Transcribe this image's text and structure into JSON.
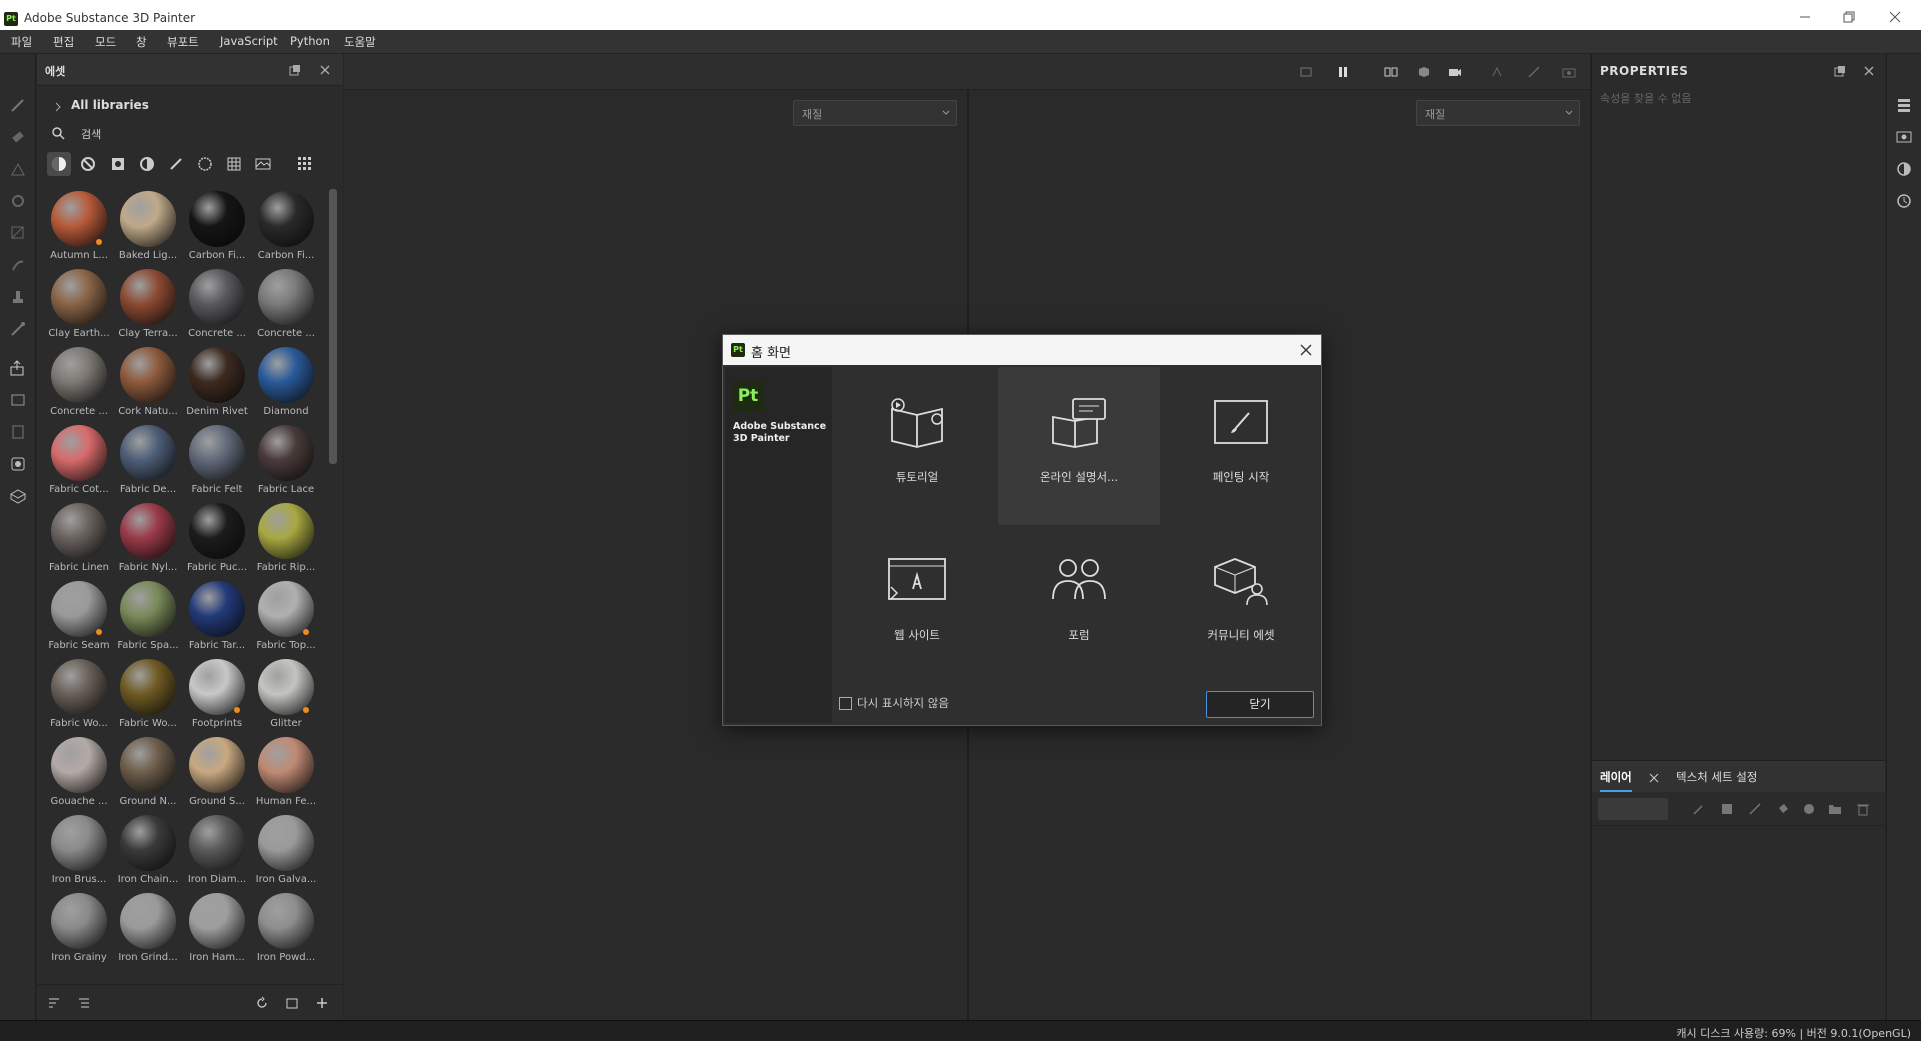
{
  "window": {
    "title": "Adobe Substance 3D Painter",
    "app_icon": "Pt"
  },
  "menu": [
    "파일",
    "편집",
    "모드",
    "창",
    "뷰포트",
    "JavaScript",
    "Python",
    "도움말"
  ],
  "assets": {
    "panel_title": "에셋",
    "library": "All libraries",
    "search_placeholder": "검색",
    "items": [
      {
        "label": "Autumn L...",
        "color": "#b85a3a",
        "new": true
      },
      {
        "label": "Baked Lig...",
        "color": "#bfa98a",
        "new": false
      },
      {
        "label": "Carbon Fi...",
        "color": "#151515",
        "new": false
      },
      {
        "label": "Carbon Fi...",
        "color": "#2a2a2a",
        "new": false
      },
      {
        "label": "Clay Earth...",
        "color": "#8a6446",
        "new": false
      },
      {
        "label": "Clay Terra...",
        "color": "#8c4a32",
        "new": false
      },
      {
        "label": "Concrete ...",
        "color": "#5a5a5e",
        "new": false
      },
      {
        "label": "Concrete ...",
        "color": "#7a7a7a",
        "new": false
      },
      {
        "label": "Concrete ...",
        "color": "#7d7873",
        "new": false
      },
      {
        "label": "Cork Natu...",
        "color": "#8e5a3c",
        "new": false
      },
      {
        "label": "Denim Rivet",
        "color": "#3d2a20",
        "new": false
      },
      {
        "label": "Diamond",
        "color": "#2a5a9a",
        "new": false
      },
      {
        "label": "Fabric Cot...",
        "color": "#d86a6a",
        "new": false
      },
      {
        "label": "Fabric De...",
        "color": "#4e5e78",
        "new": false
      },
      {
        "label": "Fabric Felt",
        "color": "#626a7a",
        "new": false
      },
      {
        "label": "Fabric Lace",
        "color": "#4a3a3a",
        "new": false
      },
      {
        "label": "Fabric Linen",
        "color": "#6a625e",
        "new": false
      },
      {
        "label": "Fabric Nyl...",
        "color": "#9a3a48",
        "new": false
      },
      {
        "label": "Fabric Puc...",
        "color": "#1c1c1c",
        "new": false
      },
      {
        "label": "Fabric Rip...",
        "color": "#a8a842",
        "new": false
      },
      {
        "label": "Fabric Seam",
        "color": "#9a9a9a",
        "new": true
      },
      {
        "label": "Fabric Spa...",
        "color": "#7a8a5a",
        "new": false
      },
      {
        "label": "Fabric Tar...",
        "color": "#233a7a",
        "new": false
      },
      {
        "label": "Fabric Top...",
        "color": "#b0b0b0",
        "new": true
      },
      {
        "label": "Fabric Wo...",
        "color": "#6a6058",
        "new": false
      },
      {
        "label": "Fabric Wo...",
        "color": "#6e5a22",
        "new": false
      },
      {
        "label": "Footprints",
        "color": "#c8c8c8",
        "new": true
      },
      {
        "label": "Glitter",
        "color": "#c4c4c0",
        "new": true
      },
      {
        "label": "Gouache ...",
        "color": "#b4aaa6",
        "new": false
      },
      {
        "label": "Ground N...",
        "color": "#6e5e4c",
        "new": false
      },
      {
        "label": "Ground S...",
        "color": "#c8a880",
        "new": false
      },
      {
        "label": "Human Fe...",
        "color": "#c08a74",
        "new": false
      },
      {
        "label": "Iron Brus...",
        "color": "#8a8a8a",
        "new": false
      },
      {
        "label": "Iron Chain...",
        "color": "#3a3a3a",
        "new": false
      },
      {
        "label": "Iron Diam...",
        "color": "#5a5a5a",
        "new": false
      },
      {
        "label": "Iron Galva...",
        "color": "#9a9a9a",
        "new": false
      },
      {
        "label": "Iron Grainy",
        "color": "#8a8a8a",
        "new": false
      },
      {
        "label": "Iron Grind...",
        "color": "#9a9a9a",
        "new": false
      },
      {
        "label": "Iron Ham...",
        "color": "#9e9e9e",
        "new": false
      },
      {
        "label": "Iron Powd...",
        "color": "#8e8e8e",
        "new": false
      }
    ]
  },
  "viewport": {
    "left_dropdown": "재질",
    "right_dropdown": "재질"
  },
  "properties": {
    "title": "PROPERTIES",
    "empty_text": "속성을 찾을 수 없음"
  },
  "layers": {
    "tab_layers": "레이어",
    "tab_textureset": "텍스처 세트 설정"
  },
  "status": {
    "text": "캐시 디스크 사용량:   69% | 버전 9.0.1(OpenGL)"
  },
  "dialog": {
    "title": "홈 화면",
    "app_name": "Adobe Substance 3D Painter",
    "logo": "Pt",
    "tiles": [
      {
        "label": "튜토리얼",
        "icon": "tutorial-book-icon"
      },
      {
        "label": "온라인 설명서...",
        "icon": "online-docs-icon"
      },
      {
        "label": "페인팅 시작",
        "icon": "paint-brush-icon"
      },
      {
        "label": "웹 사이트",
        "icon": "adobe-website-icon"
      },
      {
        "label": "포럼",
        "icon": "forum-people-icon"
      },
      {
        "label": "커뮤니티 에셋",
        "icon": "community-assets-icon"
      }
    ],
    "dont_show_label": "다시 표시하지 않음",
    "dont_show_checked": false,
    "close_button": "닫기"
  },
  "colors": {
    "accent": "#4a9fe8",
    "new_badge": "#f08a20",
    "pt_green": "#8cf05a"
  }
}
